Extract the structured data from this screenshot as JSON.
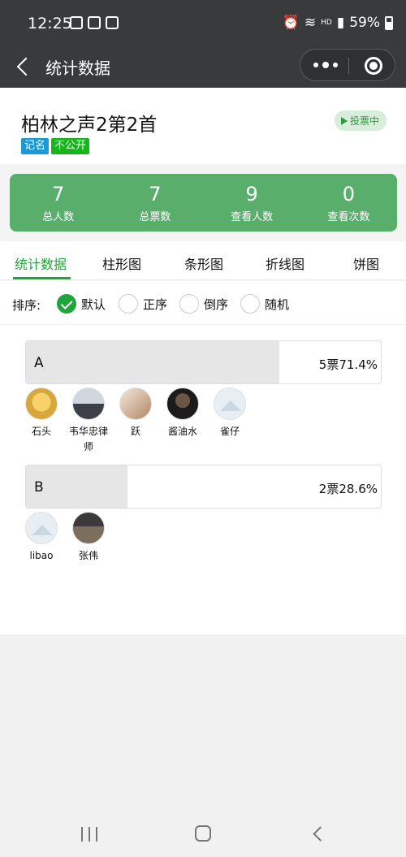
{
  "status": {
    "time": "12:25",
    "battery": "59%",
    "net": "HD"
  },
  "nav": {
    "title": "统计数据"
  },
  "poll": {
    "title": "柏林之声2第2首",
    "badges": [
      "记名",
      "不公开"
    ],
    "state": "投票中"
  },
  "stats": [
    {
      "num": "7",
      "label": "总人数"
    },
    {
      "num": "7",
      "label": "总票数"
    },
    {
      "num": "9",
      "label": "查看人数"
    },
    {
      "num": "0",
      "label": "查看次数"
    }
  ],
  "tabs": [
    "统计数据",
    "柱形图",
    "条形图",
    "折线图",
    "饼图"
  ],
  "active_tab": 0,
  "sort": {
    "label": "排序:",
    "options": [
      "默认",
      "正序",
      "倒序",
      "随机"
    ],
    "selected": 0
  },
  "options": [
    {
      "letter": "A",
      "count_text": "5票71.4%",
      "percent": 71.4,
      "voters": [
        {
          "name": "石头",
          "avatar": "yellow"
        },
        {
          "name": "韦华忠律师",
          "avatar": "suit"
        },
        {
          "name": "跃",
          "avatar": "sand"
        },
        {
          "name": "酱油水",
          "avatar": "dark"
        },
        {
          "name": "雀仔",
          "avatar": "blank"
        }
      ]
    },
    {
      "letter": "B",
      "count_text": "2票28.6%",
      "percent": 28.6,
      "voters": [
        {
          "name": "libao",
          "avatar": "blank"
        },
        {
          "name": "张伟",
          "avatar": "man"
        }
      ]
    }
  ]
}
